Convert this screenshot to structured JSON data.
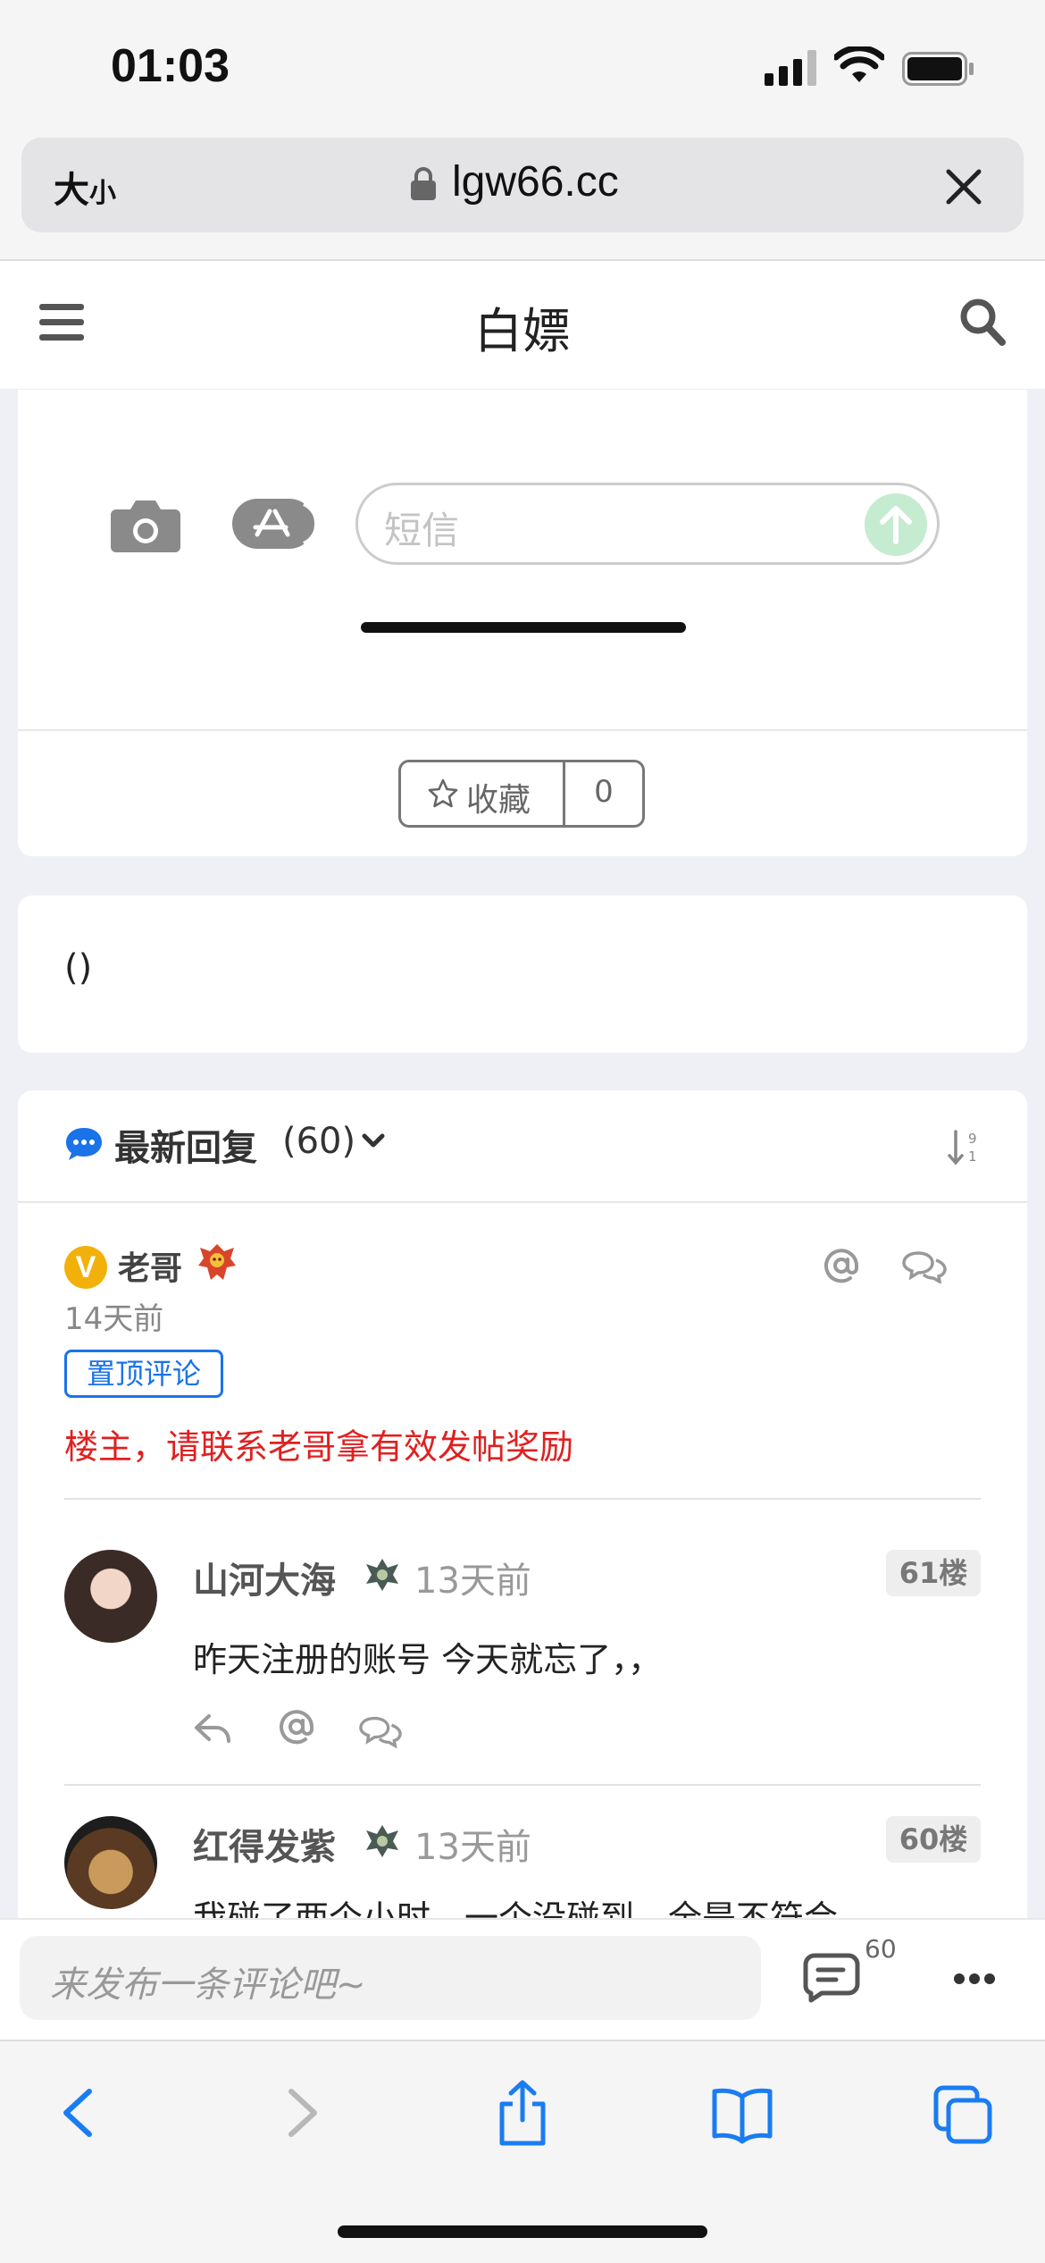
{
  "status_bar": {
    "time": "01:03"
  },
  "browser": {
    "text_size_label": "大",
    "text_size_small": "小",
    "domain": "lgw66.cc"
  },
  "site": {
    "title": "白嫖"
  },
  "message_mock": {
    "placeholder": "短信"
  },
  "favorite": {
    "label": "收藏",
    "count": "0"
  },
  "content": {
    "text": "()"
  },
  "comments": {
    "header_label": "最新回复",
    "header_count": "(60)",
    "pinned": {
      "vip_letter": "V",
      "user": "老哥",
      "time": "14天前",
      "tag": "置顶评论",
      "text": "楼主，请联系老哥拿有效发帖奖励"
    },
    "items": [
      {
        "user": "山河大海",
        "time": "13天前",
        "floor": "61楼",
        "text": "昨天注册的账号  今天就忘了，，"
      },
      {
        "user": "红得发紫",
        "time": "13天前",
        "floor": "60楼",
        "text": "我碰了两个小时，一个没碰到，全是不符合"
      }
    ]
  },
  "comment_bar": {
    "placeholder": "来发布一条评论吧~",
    "count": "60"
  },
  "colors": {
    "accent_blue": "#1a73e8",
    "pinned_red": "#e02020",
    "vip_gold": "#f2b10a"
  }
}
